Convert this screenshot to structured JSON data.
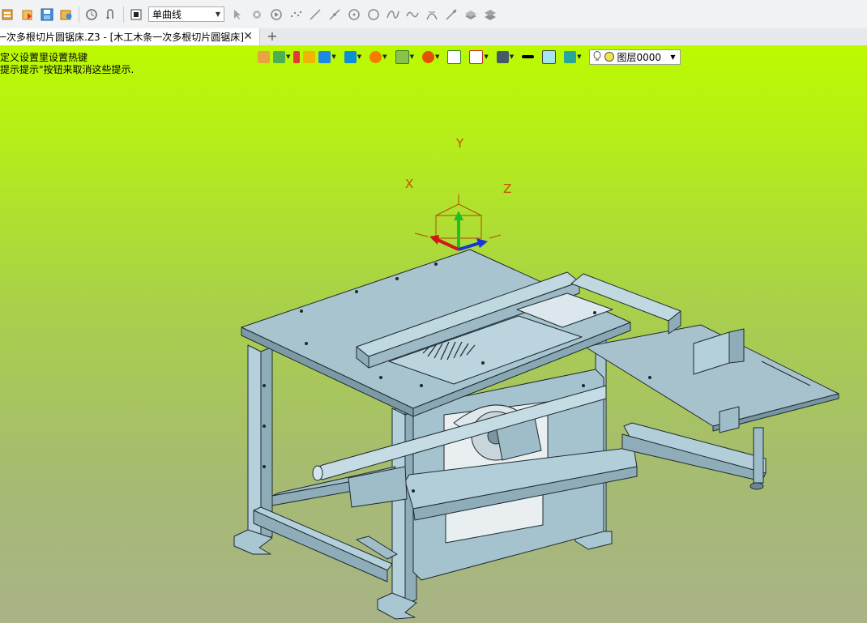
{
  "toolbar": {
    "curve_type": "单曲线",
    "icons": [
      "new-file",
      "open-file",
      "save-file",
      "export",
      "history",
      "undo-redo",
      "stop-square",
      "curve-type-dropdown",
      "pointer",
      "pick-filter",
      "play",
      "dotted-line",
      "line",
      "angle-line",
      "circle-point",
      "circle",
      "spline",
      "wave",
      "arc",
      "tangent-line",
      "surface",
      "surface-stack"
    ]
  },
  "tabs": {
    "active": "一次多根切片圆锯床.Z3 - [木工木条一次多根切片圆锯床]",
    "add": "+"
  },
  "viewport": {
    "hint_line1": "定义设置里设置热键",
    "hint_line2": "提示提示\"按钮来取消这些提示.",
    "layer": "图层0000",
    "background_top": "#bcfa00",
    "background_bottom": "#a8b387",
    "model_color": "#a9c7d3"
  },
  "triad": {
    "x": "X",
    "y": "Y",
    "z": "Z"
  }
}
